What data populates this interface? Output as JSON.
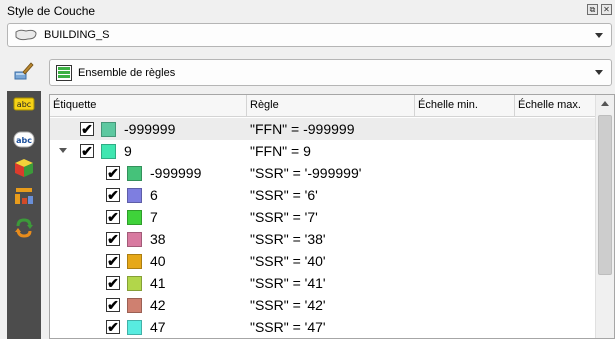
{
  "window": {
    "title": "Style de Couche",
    "float_button_glyph": "⧉",
    "close_button_glyph": "✕"
  },
  "layer_combo": {
    "value": "BUILDING_S"
  },
  "renderer_combo": {
    "value": "Ensemble de règles"
  },
  "sidebar": {
    "icons": [
      "paintbrush-icon",
      "labels-icon",
      "labels-abc-icon",
      "3d-box-icon",
      "diagram-icon",
      "history-icon"
    ]
  },
  "table": {
    "columns": [
      "Étiquette",
      "Règle",
      "Échelle min.",
      "Échelle max."
    ],
    "rows": [
      {
        "label": "-999999",
        "rule": "\"FFN\" = -999999",
        "color": "#5dc8a0",
        "checked": "✔",
        "level": 1,
        "selected": true
      },
      {
        "label": "9",
        "rule": "\"FFN\" = 9",
        "color": "#3fe6b0",
        "checked": "✔",
        "level": 1,
        "expanded": true
      },
      {
        "label": "-999999",
        "rule": "\"SSR\" = '-999999'",
        "color": "#45c27a",
        "checked": "✔",
        "level": 2
      },
      {
        "label": "6",
        "rule": "\"SSR\" = '6'",
        "color": "#7e7ee0",
        "checked": "✔",
        "level": 2
      },
      {
        "label": "7",
        "rule": "\"SSR\" = '7'",
        "color": "#3fd23a",
        "checked": "✔",
        "level": 2
      },
      {
        "label": "38",
        "rule": "\"SSR\" = '38'",
        "color": "#d87aa0",
        "checked": "✔",
        "level": 2
      },
      {
        "label": "40",
        "rule": "\"SSR\" = '40'",
        "color": "#e6a818",
        "checked": "✔",
        "level": 2
      },
      {
        "label": "41",
        "rule": "\"SSR\" = '41'",
        "color": "#b2d64a",
        "checked": "✔",
        "level": 2
      },
      {
        "label": "42",
        "rule": "\"SSR\" = '42'",
        "color": "#cf8070",
        "checked": "✔",
        "level": 2
      },
      {
        "label": "47",
        "rule": "\"SSR\" = '47'",
        "color": "#58ece0",
        "checked": "✔",
        "level": 2
      }
    ]
  }
}
